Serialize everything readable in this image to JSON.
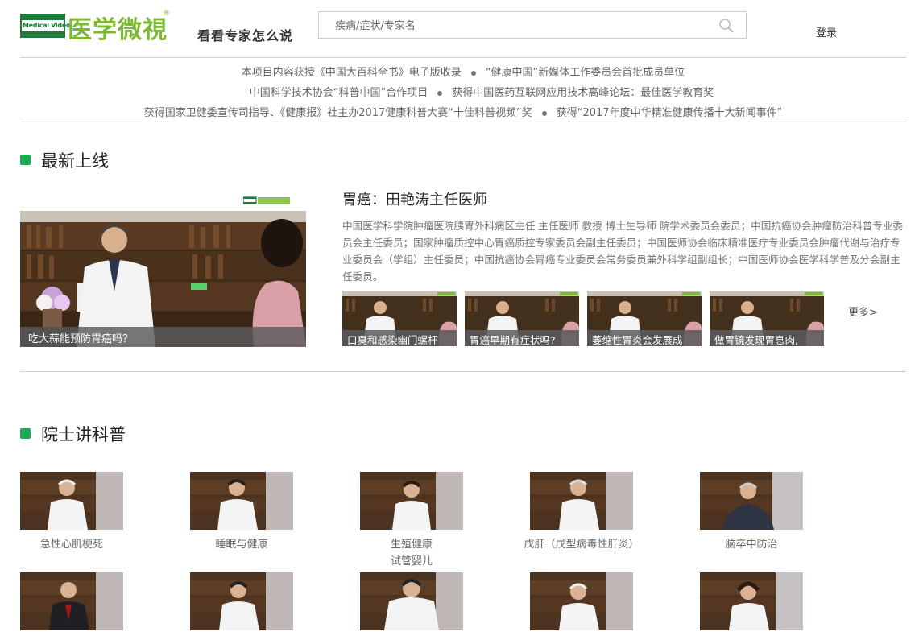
{
  "header": {
    "logo_en": "Medical Video",
    "logo_cn": "医学微視",
    "logo_mark": "®",
    "slogan": "看看专家怎么说",
    "search_placeholder": "疾病/症状/专家名",
    "login_label": "登录"
  },
  "honors": {
    "rows": [
      [
        "本项目内容获授《中国大百科全书》电子版收录",
        "“健康中国”新媒体工作委员会首批成员单位"
      ],
      [
        "中国科学技术协会“科普中国”合作项目",
        "获得中国医药互联网应用技术高峰论坛：最佳医学教育奖"
      ],
      [
        "获得国家卫健委宣传司指导、《健康报》社主办2017健康科普大赛“十佳科普视频”奖",
        "获得“2017年度中华精准健康传播十大新闻事件”"
      ]
    ]
  },
  "latest": {
    "section_title": "最新上线",
    "featured_caption": "吃大蒜能预防胃癌吗？",
    "doctor_title": "胃癌：田艳涛主任医师",
    "doctor_desc": "中国医学科学院肿瘤医院胰胃外科病区主任 主任医师 教授 博士生导师 院学术委员会委员；中国抗癌协会肿瘤防治科普专业委员会主任委员；国家肿瘤质控中心胃癌质控专家委员会副主任委员；中国医师协会临床精准医疗专业委员会肿瘤代谢与治疗专业委员会（学组）主任委员；中国抗癌协会胃癌专业委员会常务委员兼外科学组副组长；中国医师协会医学科学普及分会副主任委员。",
    "thumbs": [
      "口臭和感染幽门螺杆",
      "胃癌早期有症状吗?",
      "萎缩性胃炎会发展成",
      "做胃镜发现胃息肉,"
    ],
    "more_label": "更多>"
  },
  "academician": {
    "section_title": "院士讲科普",
    "row1": [
      "急性心肌梗死",
      "睡眠与健康",
      "生殖健康\n试管婴儿",
      "戊肝（戊型病毒性肝炎）",
      "脑卒中防治"
    ]
  },
  "colors": {
    "accent_green": "#1aab52",
    "logo_green": "#7cb832",
    "logo_dark_green": "#1f7a3c"
  }
}
